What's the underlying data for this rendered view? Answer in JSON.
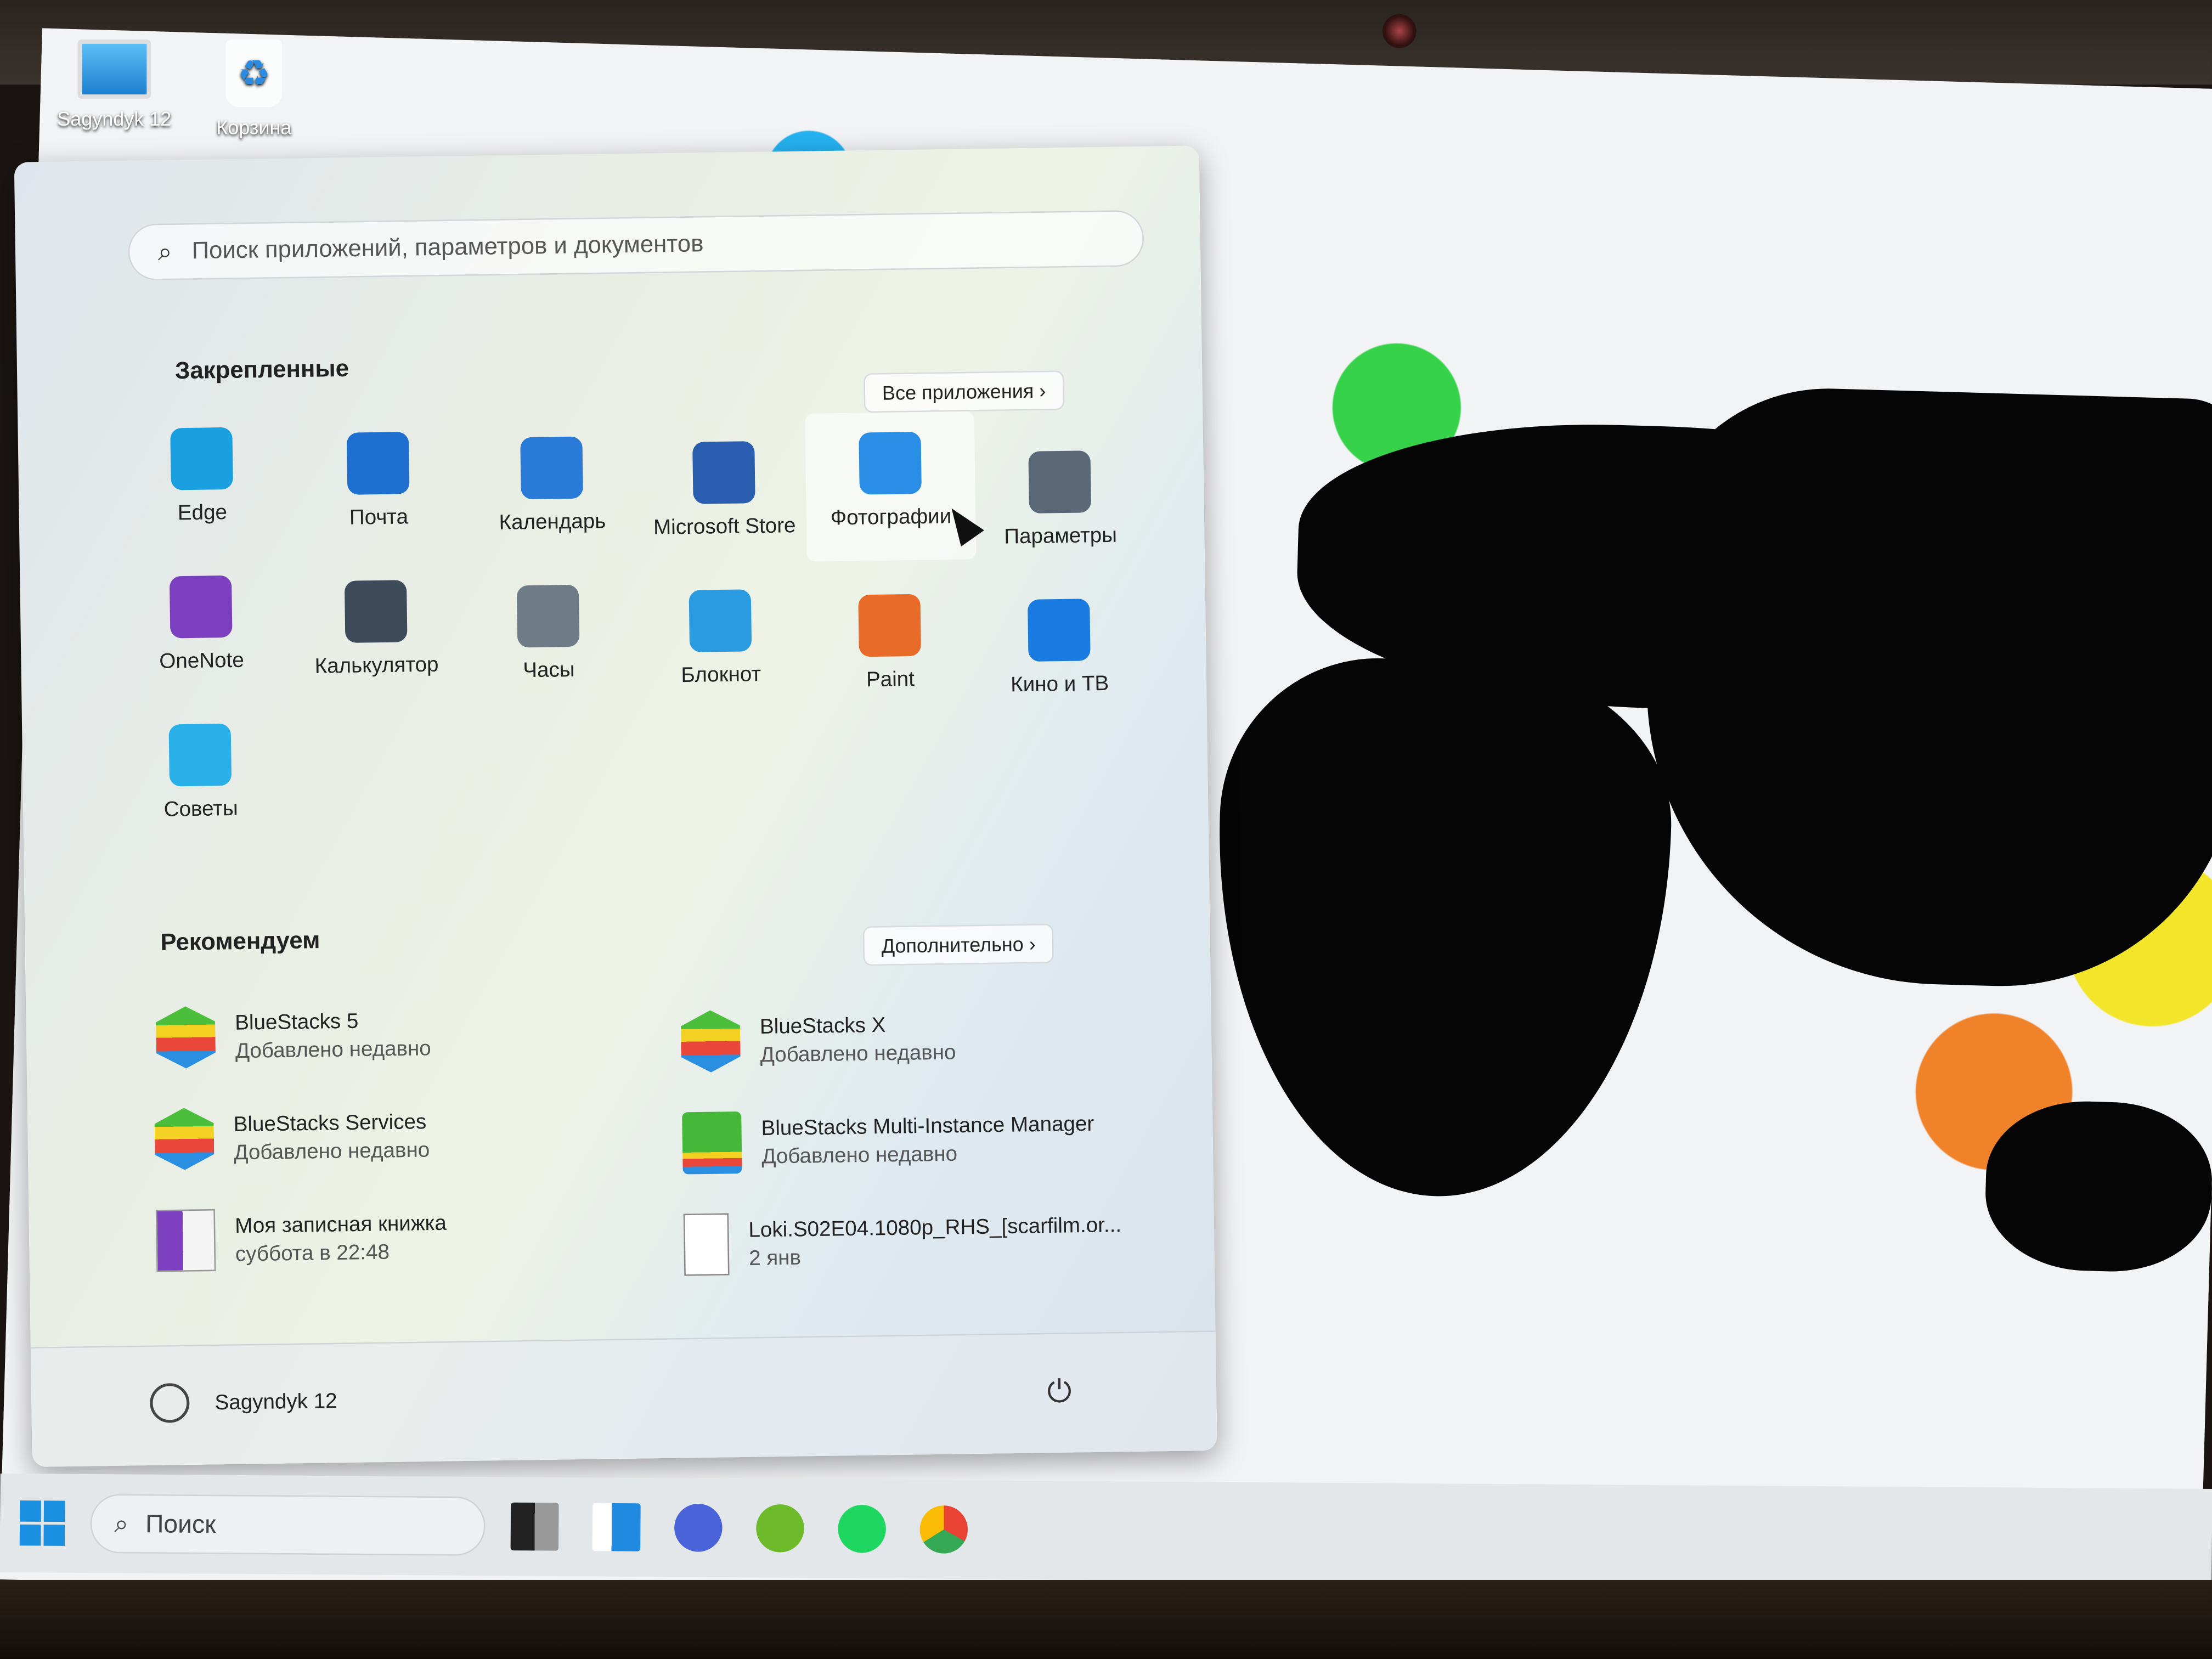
{
  "desktop": {
    "icons": [
      {
        "label": "Sagyndyk 12",
        "icon": "monitor-icon"
      },
      {
        "label": "Корзина",
        "icon": "recycle-bin-icon"
      }
    ]
  },
  "start": {
    "search_placeholder": "Поиск приложений, параметров и документов",
    "pinned_title": "Закрепленные",
    "all_apps": "Все приложения",
    "pinned": [
      {
        "label": "Edge",
        "icon": "edge-icon",
        "color": "#1aa0e0"
      },
      {
        "label": "Почта",
        "icon": "mail-icon",
        "color": "#1f6fd0"
      },
      {
        "label": "Календарь",
        "icon": "calendar-icon",
        "color": "#2a7ad8"
      },
      {
        "label": "Microsoft Store",
        "icon": "store-icon",
        "color": "#2a5db0"
      },
      {
        "label": "Фотографии",
        "icon": "photos-icon",
        "color": "#2a8ee6"
      },
      {
        "label": "Параметры",
        "icon": "gear-icon",
        "color": "#5a6878"
      },
      {
        "label": "OneNote",
        "icon": "onenote-icon",
        "color": "#7b3fbf"
      },
      {
        "label": "Калькулятор",
        "icon": "calculator-icon",
        "color": "#3c4a5a"
      },
      {
        "label": "Часы",
        "icon": "clock-icon",
        "color": "#6f7c88"
      },
      {
        "label": "Блокнот",
        "icon": "notepad-icon",
        "color": "#2a9be0"
      },
      {
        "label": "Paint",
        "icon": "paint-icon",
        "color": "#e96b2a"
      },
      {
        "label": "Кино и ТВ",
        "icon": "movies-tv-icon",
        "color": "#1a7be0"
      },
      {
        "label": "Советы",
        "icon": "tips-icon",
        "color": "#2ab0e8"
      }
    ],
    "recommended_title": "Рекомендуем",
    "more": "Дополнительно",
    "recommended": [
      {
        "name": "BlueStacks 5",
        "sub": "Добавлено недавно",
        "icon": "bluestacks-icon"
      },
      {
        "name": "BlueStacks X",
        "sub": "Добавлено недавно",
        "icon": "bluestacks-icon"
      },
      {
        "name": "BlueStacks Services",
        "sub": "Добавлено недавно",
        "icon": "bluestacks-icon"
      },
      {
        "name": "BlueStacks Multi-Instance Manager",
        "sub": "Добавлено недавно",
        "icon": "bluestacks-multi-icon"
      },
      {
        "name": "Моя записная книжка",
        "sub": "суббота в 22:48",
        "icon": "onenote-file-icon"
      },
      {
        "name": "Loki.S02E04.1080p_RHS_[scarfilm.or...",
        "sub": "2 янв",
        "icon": "file-icon"
      }
    ],
    "user": "Sagyndyk 12"
  },
  "taskbar": {
    "search": "Поиск",
    "apps": [
      "task-view-icon",
      "widgets-icon",
      "teams-chat-icon",
      "utorrent-icon",
      "spotify-icon",
      "chrome-icon"
    ]
  }
}
